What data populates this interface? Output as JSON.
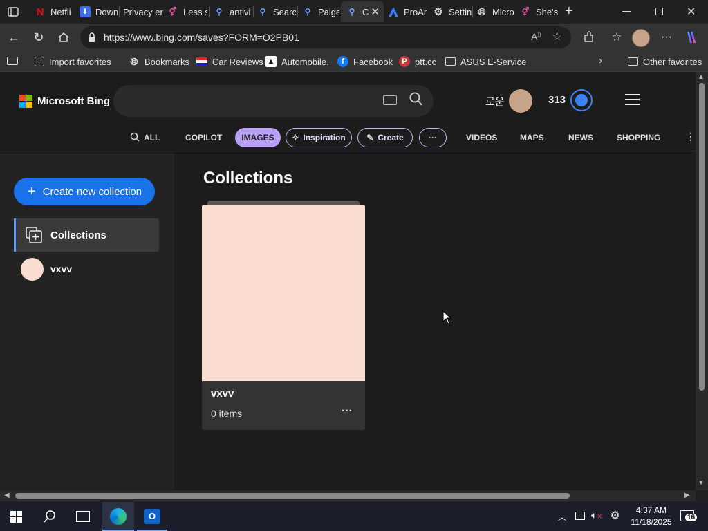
{
  "tabs": [
    {
      "label": "Netfli",
      "icon": "netflix-icon"
    },
    {
      "label": "Down",
      "icon": "download-icon"
    },
    {
      "label": "Privacy err",
      "icon": "warning-icon"
    },
    {
      "label": "Less s",
      "icon": "tab-icon"
    },
    {
      "label": "antivi",
      "icon": "search-icon"
    },
    {
      "label": "Searc",
      "icon": "search-icon"
    },
    {
      "label": "Paige",
      "icon": "search-icon"
    },
    {
      "label": "C",
      "icon": "search-icon"
    },
    {
      "label": "ProAr",
      "icon": "proart-icon"
    },
    {
      "label": "Settin",
      "icon": "gear-icon"
    },
    {
      "label": "Micro",
      "icon": "globe-icon"
    },
    {
      "label": "She's",
      "icon": "tab-icon"
    }
  ],
  "address": {
    "url": "https://www.bing.com/saves?FORM=O2PB01"
  },
  "favorites": [
    {
      "label": "Import favorites"
    },
    {
      "label": "Bookmarks"
    },
    {
      "label": "Car Reviews"
    },
    {
      "label": "Automobile."
    },
    {
      "label": "Facebook"
    },
    {
      "label": "ptt.cc"
    },
    {
      "label": "ASUS E-Service"
    },
    {
      "label": "Other favorites"
    }
  ],
  "bing": {
    "logo_text": "Microsoft Bing",
    "user_name": "로운",
    "points": "313",
    "scopes": {
      "all": "ALL",
      "copilot": "COPILOT",
      "images": "IMAGES",
      "inspiration": "Inspiration",
      "create": "Create",
      "more": "···",
      "videos": "VIDEOS",
      "maps": "MAPS",
      "news": "NEWS",
      "shopping": "SHOPPING"
    }
  },
  "sidebar": {
    "create_button": "Create new collection",
    "collections_label": "Collections",
    "items": [
      {
        "label": "vxvv"
      }
    ]
  },
  "main": {
    "heading": "Collections",
    "cards": [
      {
        "title": "vxvv",
        "count": "0 items",
        "more": "···"
      }
    ]
  },
  "taskbar": {
    "time": "4:37 AM",
    "date": "11/18/2025",
    "notifications": "16"
  },
  "colors": {
    "accent_blue": "#1a73e8",
    "card_thumb": "#fadcd1",
    "pill_purple": "#b8a1f5"
  }
}
